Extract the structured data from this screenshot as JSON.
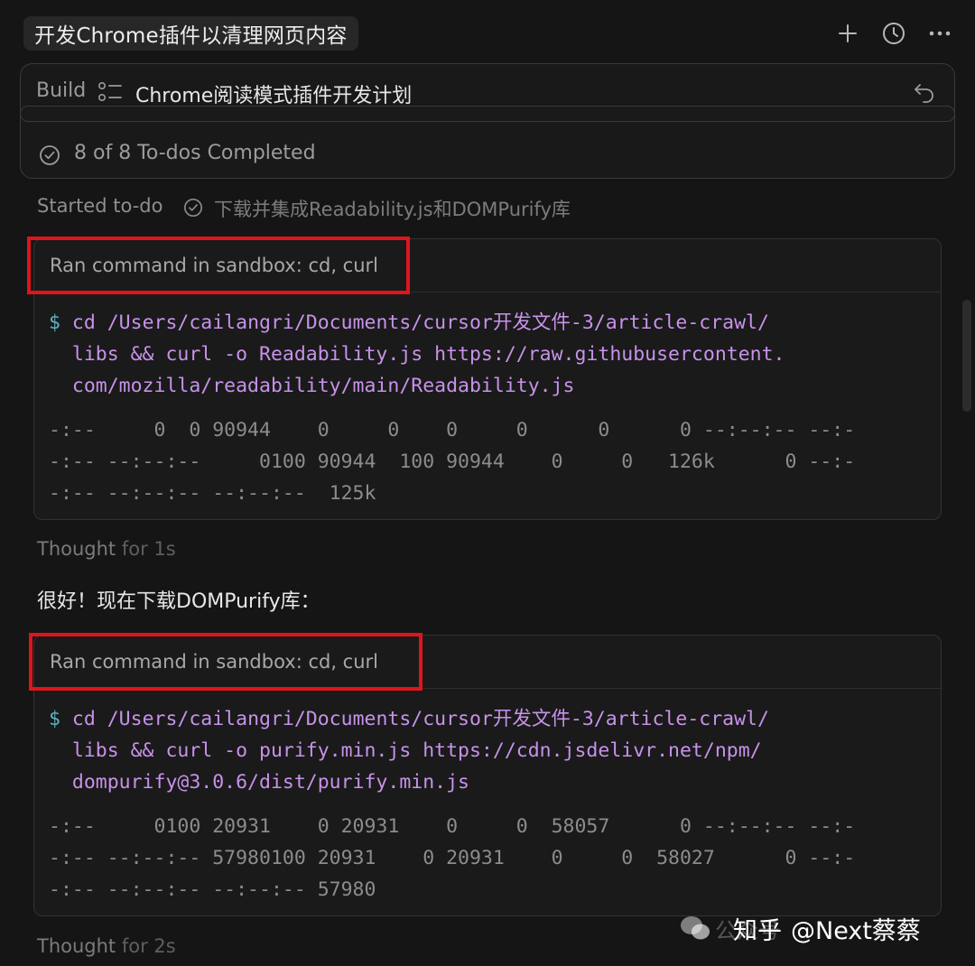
{
  "header": {
    "title": "开发Chrome插件以清理网页内容",
    "icons": [
      "plus-icon",
      "history-icon",
      "more-icon"
    ]
  },
  "plan": {
    "mode_label": "Build",
    "title": "Chrome阅读模式插件开发计划",
    "status": "8 of 8 To-dos Completed"
  },
  "started": {
    "label": "Started to-do",
    "task": "下载并集成Readability.js和DOMPurify库"
  },
  "commands": [
    {
      "header": "Ran command in sandbox: cd, curl",
      "prompt": "$",
      "lines": [
        "cd /Users/cailangri/Documents/cursor开发文件-3/article-crawl/",
        "libs && curl -o Readability.js https://raw.githubusercontent.",
        "com/mozilla/readability/main/Readability.js"
      ],
      "output": [
        "-:--     0  0 90944    0     0    0     0      0      0 --:--:-- --:-",
        "-:-- --:--:--     0100 90944  100 90944    0     0   126k      0 --:-",
        "-:-- --:--:-- --:--:--  125k"
      ]
    },
    {
      "header": "Ran command in sandbox: cd, curl",
      "prompt": "$",
      "lines": [
        "cd /Users/cailangri/Documents/cursor开发文件-3/article-crawl/",
        "libs && curl -o purify.min.js https://cdn.jsdelivr.net/npm/",
        "dompurify@3.0.6/dist/purify.min.js"
      ],
      "output": [
        "-:--     0100 20931    0 20931    0     0  58057      0 --:--:-- --:-",
        "-:-- --:--:-- 57980100 20931    0 20931    0     0  58027      0 --:-",
        "-:-- --:--:-- --:--:-- 57980"
      ]
    }
  ],
  "thoughts": [
    {
      "label": "Thought",
      "duration": "for 1s"
    },
    {
      "label": "Thought",
      "duration": "for 2s"
    }
  ],
  "reply": "很好！现在下载DOMPurify库：",
  "watermark": {
    "platform": "知乎",
    "faded": "公众号",
    "handle": "@Next蔡蔡"
  },
  "colors": {
    "background": "#151515",
    "command_text": "#c792ea",
    "prompt": "#5fb3c4",
    "highlight_box": "#e0141c"
  }
}
